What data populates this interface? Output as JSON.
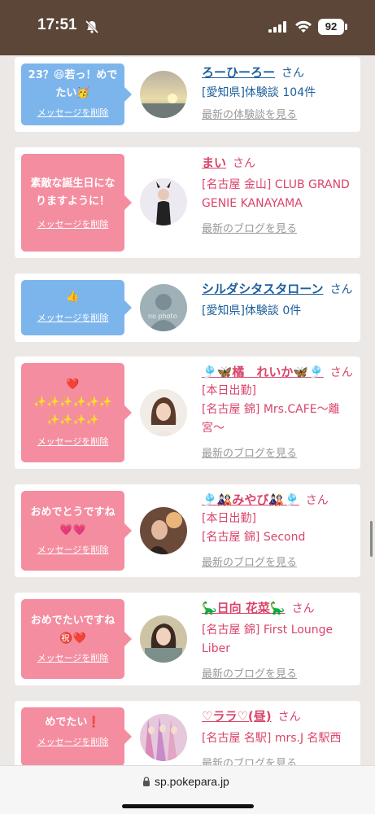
{
  "status": {
    "time": "17:51",
    "battery": "92"
  },
  "cards": [
    {
      "bubble_color": "blue",
      "message": "23？😆若っ！めでたい🥳",
      "delete_label": "メッセージを削除",
      "name": "ろーひーろー",
      "san": "さん",
      "details": [
        "[愛知県]体験談 104件"
      ],
      "link": "最新の体験談を見る",
      "name_color": "blue"
    },
    {
      "bubble_color": "pink",
      "message": "素敵な誕生日になりますように！",
      "delete_label": "メッセージを削除",
      "name": "まい",
      "san": "さん",
      "details": [
        "[名古屋 金山] CLUB GRAND GENIE KANAYAMA"
      ],
      "link": "最新のブログを見る",
      "name_color": "pink"
    },
    {
      "bubble_color": "blue",
      "message": "👍",
      "delete_label": "メッセージを削除",
      "name": "シルダシタスタローン",
      "san": "さん",
      "details": [
        "[愛知県]体験談 0件"
      ],
      "link": "",
      "avatar_text": "no photo",
      "name_color": "blue"
    },
    {
      "bubble_color": "pink",
      "message": "❤️ ✨✨✨✨✨✨ ✨✨✨✨",
      "delete_label": "メッセージを削除",
      "name": "🎐🦋橘　れいか🦋🎐",
      "san": "さん",
      "details": [
        "[本日出勤]",
        "[名古屋 錦] Mrs.CAFE〜離宮〜"
      ],
      "link": "最新のブログを見る",
      "name_color": "pink"
    },
    {
      "bubble_color": "pink",
      "message": "おめでとうですね💗💗",
      "delete_label": "メッセージを削除",
      "name": "🎐🎎みやび🎎🎐",
      "san": "さん",
      "details": [
        "[本日出勤]",
        "[名古屋 錦] Second"
      ],
      "link": "最新のブログを見る",
      "name_color": "pink"
    },
    {
      "bubble_color": "pink",
      "message": "おめでたいですね㊗️❤️",
      "delete_label": "メッセージを削除",
      "name": "🦕日向 花菜🦕",
      "san": "さん",
      "details": [
        "[名古屋 錦] First Lounge Liber"
      ],
      "link": "最新のブログを見る",
      "name_color": "pink"
    },
    {
      "bubble_color": "pink",
      "message": "めでたい❗️",
      "delete_label": "メッセージを削除",
      "name": "♡ララ♡(昼)",
      "san": "さん",
      "details": [
        "[名古屋 名駅] mrs.J 名駅西"
      ],
      "link": "最新のブログを見る",
      "name_color": "pink"
    }
  ],
  "browser": {
    "url": "sp.pokepara.jp"
  },
  "colors": {
    "pink_text": "#d9456a",
    "blue_text": "#1d5f9c",
    "pink_bubble": "#f48da0",
    "blue_bubble": "#7cb5ec",
    "status_bar": "#5b4637"
  }
}
